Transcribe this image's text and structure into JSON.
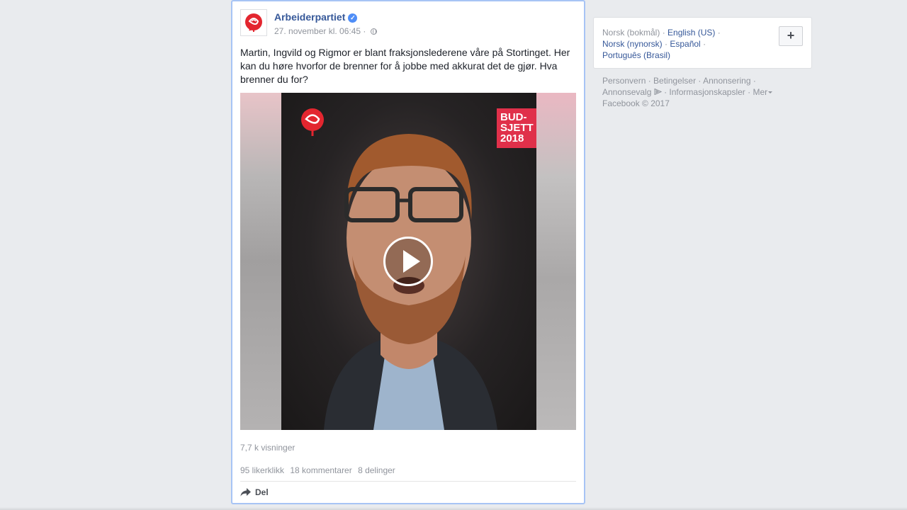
{
  "post": {
    "page_name": "Arbeiderpartiet",
    "timestamp": "27. november kl. 06:45",
    "separator": "·",
    "text": "Martin, Ingvild og Rigmor er blant fraksjonslederene våre på Stortinget. Her kan du høre hvorfor de brenner for å jobbe med akkurat det de gjør. Hva brenner du for?",
    "video": {
      "badge_lines": [
        "BUD-",
        "SJETT",
        "2018"
      ]
    },
    "views": "7,7 k visninger",
    "stats": {
      "likes": "95 likerklikk",
      "comments": "18 kommentarer",
      "shares": "8 delinger"
    },
    "share_label": "Del"
  },
  "languages": {
    "current": "Norsk (bokmål)",
    "links": [
      "English (US)",
      "Norsk (nynorsk)",
      "Español",
      "Português (Brasil)"
    ],
    "add_label": "+"
  },
  "footer": {
    "links": [
      "Personvern",
      "Betingelser",
      "Annonsering",
      "Annonsevalg",
      "Informasjonskapsler",
      "Mer"
    ],
    "copyright": "Facebook © 2017"
  },
  "colors": {
    "link": "#365899",
    "muted": "#90949c",
    "brand_red": "#e0304a",
    "focus_border": "#a7c4f5"
  },
  "icons": [
    "verified-badge-icon",
    "globe-icon",
    "rose-logo-icon",
    "play-icon",
    "share-arrow-icon",
    "plus-icon",
    "adchoices-icon",
    "caret-down-icon"
  ]
}
